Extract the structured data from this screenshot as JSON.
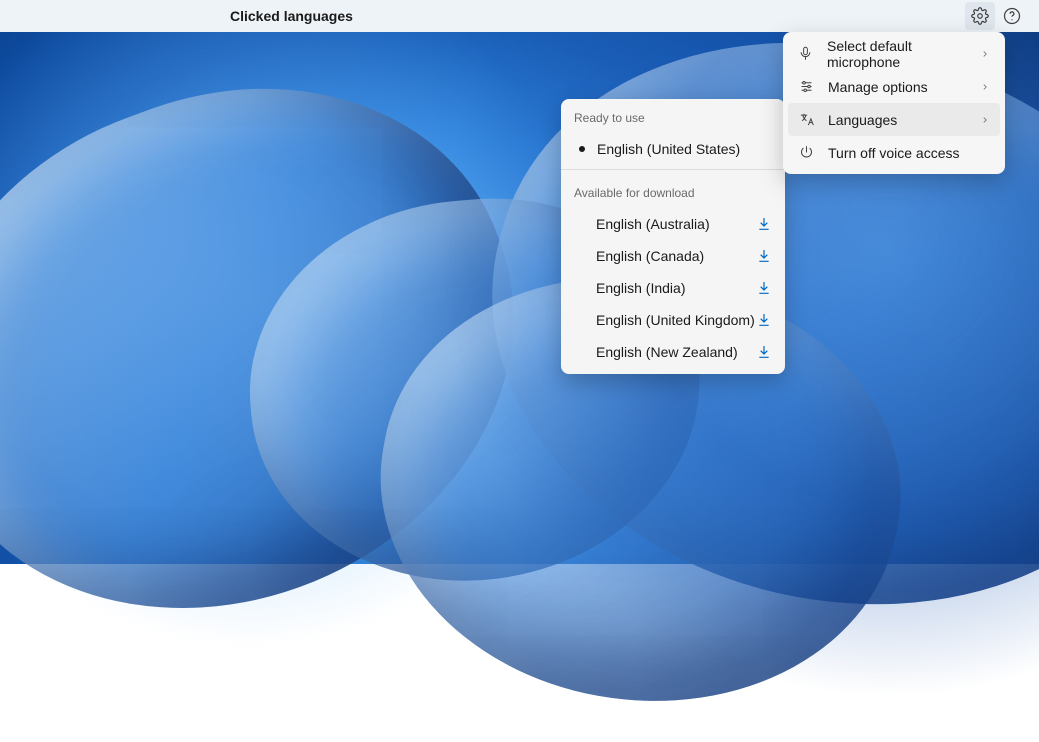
{
  "title": "Clicked languages",
  "menu": {
    "items": [
      {
        "label": "Select default microphone",
        "icon": "microphone-icon",
        "has_submenu": true,
        "highlighted": false
      },
      {
        "label": "Manage options",
        "icon": "options-icon",
        "has_submenu": true,
        "highlighted": false
      },
      {
        "label": "Languages",
        "icon": "language-icon",
        "has_submenu": true,
        "highlighted": true
      },
      {
        "label": "Turn off voice access",
        "icon": "power-icon",
        "has_submenu": false,
        "highlighted": false
      }
    ]
  },
  "languages": {
    "ready_header": "Ready to use",
    "ready": [
      {
        "label": "English (United States)",
        "selected": true
      }
    ],
    "download_header": "Available for download",
    "downloads": [
      {
        "label": "English (Australia)"
      },
      {
        "label": "English (Canada)"
      },
      {
        "label": "English (India)"
      },
      {
        "label": "English (United Kingdom)"
      },
      {
        "label": "English (New Zealand)"
      }
    ]
  }
}
